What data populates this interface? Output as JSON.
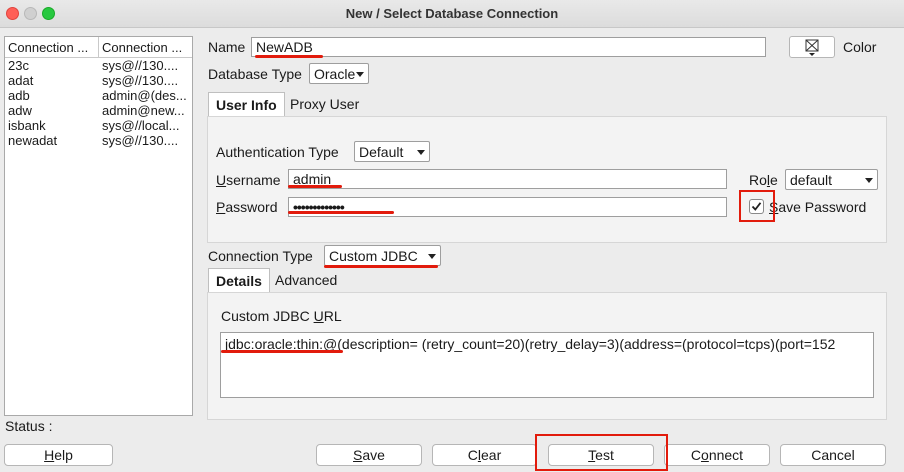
{
  "window": {
    "title": "New / Select Database Connection"
  },
  "connections": {
    "headers": [
      "Connection ...",
      "Connection ..."
    ],
    "rows": [
      {
        "name": "23c",
        "conn": "sys@//130...."
      },
      {
        "name": "adat",
        "conn": "sys@//130...."
      },
      {
        "name": "adb",
        "conn": "admin@(des..."
      },
      {
        "name": "adw",
        "conn": "admin@new..."
      },
      {
        "name": "isbank",
        "conn": "sys@//local..."
      },
      {
        "name": "newadat",
        "conn": "sys@//130...."
      }
    ]
  },
  "form": {
    "name_label": "Name",
    "name_value": "NewADB",
    "color_label": "Color",
    "db_type_label": "Database Type",
    "db_type_value": "Oracle",
    "tabs": [
      "User Info",
      "Proxy User"
    ],
    "auth_type_label": "Authentication Type",
    "auth_type_value": "Default",
    "username_label_u": "U",
    "username_label_rest": "sername",
    "username_value": "admin",
    "role_label_pre": "Ro",
    "role_label_u": "l",
    "role_label_post": "e",
    "role_value": "default",
    "password_label_u": "P",
    "password_label_rest": "assword",
    "password_value": "•••••••••••••",
    "save_password_u": "S",
    "save_password_rest": "ave Password",
    "save_password_checked": true,
    "conn_type_label": "Connection Type",
    "conn_type_value": "Custom JDBC",
    "detail_tabs": [
      "Details",
      "Advanced"
    ],
    "jdbc_label_pre": "Custom JDBC ",
    "jdbc_label_u": "U",
    "jdbc_label_post": "RL",
    "jdbc_value": "jdbc:oracle:thin:@(description= (retry_count=20)(retry_delay=3)(address=(protocol=tcps)(port=152"
  },
  "status": {
    "label": "Status :"
  },
  "buttons": {
    "help_u": "H",
    "help_rest": "elp",
    "save_u": "S",
    "save_rest": "ave",
    "clear_pre": "C",
    "clear_u": "l",
    "clear_post": "ear",
    "test_u": "T",
    "test_rest": "est",
    "connect_pre": "C",
    "connect_u": "o",
    "connect_post": "nnect",
    "cancel_label": "Cancel"
  },
  "annotation_color": "#e21b0c"
}
